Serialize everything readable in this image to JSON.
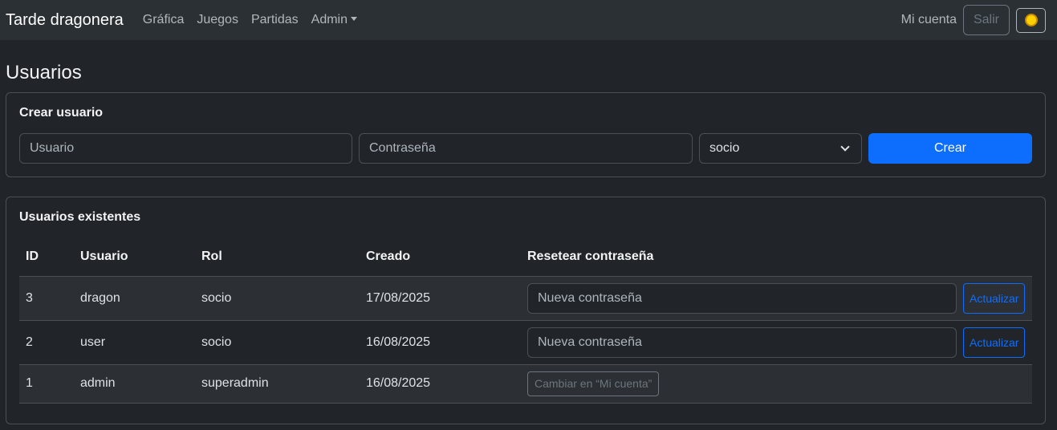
{
  "navbar": {
    "brand": "Tarde dragonera",
    "links": [
      "Gráfica",
      "Juegos",
      "Partidas",
      "Admin"
    ],
    "account": "Mi cuenta",
    "logout": "Salir",
    "theme_icon": "sun-icon"
  },
  "page": {
    "title": "Usuarios"
  },
  "create": {
    "title": "Crear usuario",
    "username_placeholder": "Usuario",
    "password_placeholder": "Contraseña",
    "role_selected": "socio",
    "submit": "Crear"
  },
  "users": {
    "title": "Usuarios existentes",
    "columns": [
      "ID",
      "Usuario",
      "Rol",
      "Creado",
      "Resetear contraseña"
    ],
    "rows": [
      {
        "id": "3",
        "user": "dragon",
        "role": "socio",
        "created": "17/08/2025",
        "reset_placeholder": "Nueva contraseña",
        "action": "Actualizar"
      },
      {
        "id": "2",
        "user": "user",
        "role": "socio",
        "created": "16/08/2025",
        "reset_placeholder": "Nueva contraseña",
        "action": "Actualizar"
      },
      {
        "id": "1",
        "user": "admin",
        "role": "superadmin",
        "created": "16/08/2025",
        "reset_note": "Cambiar en “Mi cuenta”"
      }
    ]
  },
  "colors": {
    "primary": "#0d6efd",
    "background": "#212529",
    "navbar": "#2b3035"
  }
}
